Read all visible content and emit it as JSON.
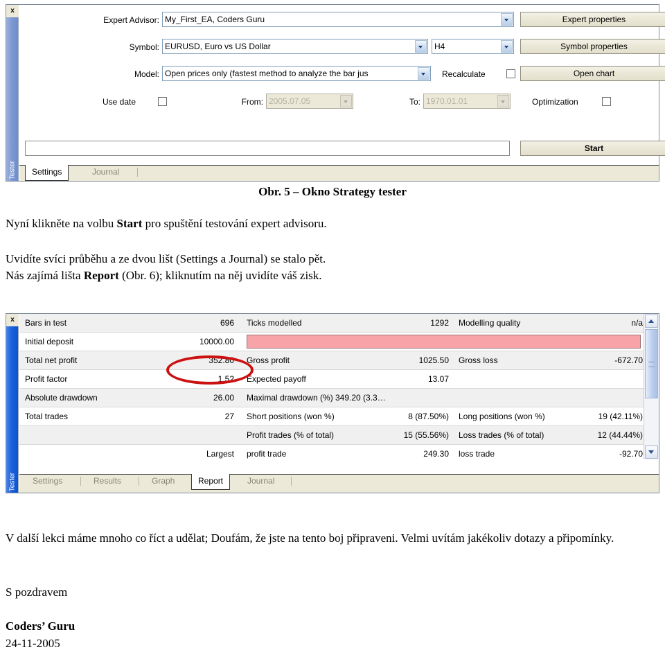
{
  "panel_settings": {
    "rail_label": "Tester",
    "close_label": "x",
    "fields": {
      "expert_advisor": {
        "label": "Expert Advisor:",
        "value": "My_First_EA, Coders Guru"
      },
      "symbol": {
        "label": "Symbol:",
        "value": "EURUSD, Euro vs US Dollar"
      },
      "timeframe": {
        "value": "H4"
      },
      "model": {
        "label": "Model:",
        "value": "Open prices only (fastest method to analyze the bar jus"
      },
      "use_date": {
        "label": "Use date"
      },
      "from": {
        "label": "From:",
        "value": "2005.07.05"
      },
      "to": {
        "label": "To:",
        "value": "1970.01.01"
      },
      "recalculate": {
        "label": "Recalculate"
      },
      "optimization": {
        "label": "Optimization"
      }
    },
    "buttons": {
      "expert_properties": "Expert properties",
      "symbol_properties": "Symbol properties",
      "open_chart": "Open chart",
      "start": "Start"
    },
    "progress_value": "",
    "tabs": [
      {
        "label": "Settings",
        "active": true
      },
      {
        "label": "Journal",
        "active": false
      }
    ]
  },
  "figure_caption": "Obr. 5 – Okno Strategy tester",
  "body_text": {
    "p1_before": "Nyní klikněte na volbu ",
    "p1_bold": "Start",
    "p1_after": " pro spuštění testování expert advisoru.",
    "p2_line1": "Uvidíte svíci průběhu a ze dvou lišt (Settings a Journal) se stalo pět.",
    "p2_before": "Nás zajímá lišta ",
    "p2_bold": "Report",
    "p2_after": " (Obr. 6); kliknutím na něj uvidíte váš zisk.",
    "p3": "V další lekci máme mnoho co říct a udělat; Doufám, že jste na tento boj připraveni. Velmi uvítám jakékoliv dotazy a připomínky.",
    "p4": "S pozdravem",
    "signature": "Coders’ Guru",
    "date": "24-11-2005"
  },
  "panel_report": {
    "rail_label": "Tester",
    "close_label": "x",
    "tabs": [
      {
        "label": "Settings",
        "active": false
      },
      {
        "label": "Results",
        "active": false
      },
      {
        "label": "Graph",
        "active": false
      },
      {
        "label": "Report",
        "active": true
      },
      {
        "label": "Journal",
        "active": false
      }
    ],
    "highlighted_value": "352.80",
    "rows": [
      {
        "c1": "Bars in test",
        "v1": "696",
        "c2": "Ticks modelled",
        "v2": "1292",
        "c3": "Modelling quality",
        "v3": "n/a",
        "shade": true
      },
      {
        "c1": "Initial deposit",
        "v1": "10000.00",
        "c2": "",
        "v2": "",
        "c3": "",
        "v3": "",
        "shade": false,
        "pink": true
      },
      {
        "c1": "Total net profit",
        "v1": "352.80",
        "c2": "Gross profit",
        "v2": "1025.50",
        "c3": "Gross loss",
        "v3": "-672.70",
        "shade": true
      },
      {
        "c1": "Profit factor",
        "v1": "1.52",
        "c2": "Expected payoff",
        "v2": "13.07",
        "c3": "",
        "v3": "",
        "shade": false
      },
      {
        "c1": "Absolute drawdown",
        "v1": "26.00",
        "c2": "Maximal drawdown (%)",
        "v2": "349.20 (3.3…",
        "c3": "",
        "v3": "",
        "shade": true
      },
      {
        "c1": "Total trades",
        "v1": "27",
        "c2": "Short positions (won %)",
        "v2": "8 (87.50%)",
        "c3": "Long positions (won %)",
        "v3": "19 (42.11%)",
        "shade": false
      },
      {
        "c1": "",
        "v1": "",
        "c2": "Profit trades (% of total)",
        "v2": "15 (55.56%)",
        "c3": "Loss trades (% of total)",
        "v3": "12 (44.44%)",
        "shade": true
      },
      {
        "c1": "",
        "v1": "Largest",
        "c2": "profit trade",
        "v2": "249.30",
        "c3": "loss trade",
        "v3": "-92.70",
        "shade": false
      }
    ]
  },
  "colors": {
    "pink_bar": "#f7a3a8",
    "highlight_ellipse": "#cc1111",
    "tester_rail_settings": "#7e99d2",
    "tester_rail_report": "#1d63dd",
    "button_face": "#ece9d8"
  }
}
